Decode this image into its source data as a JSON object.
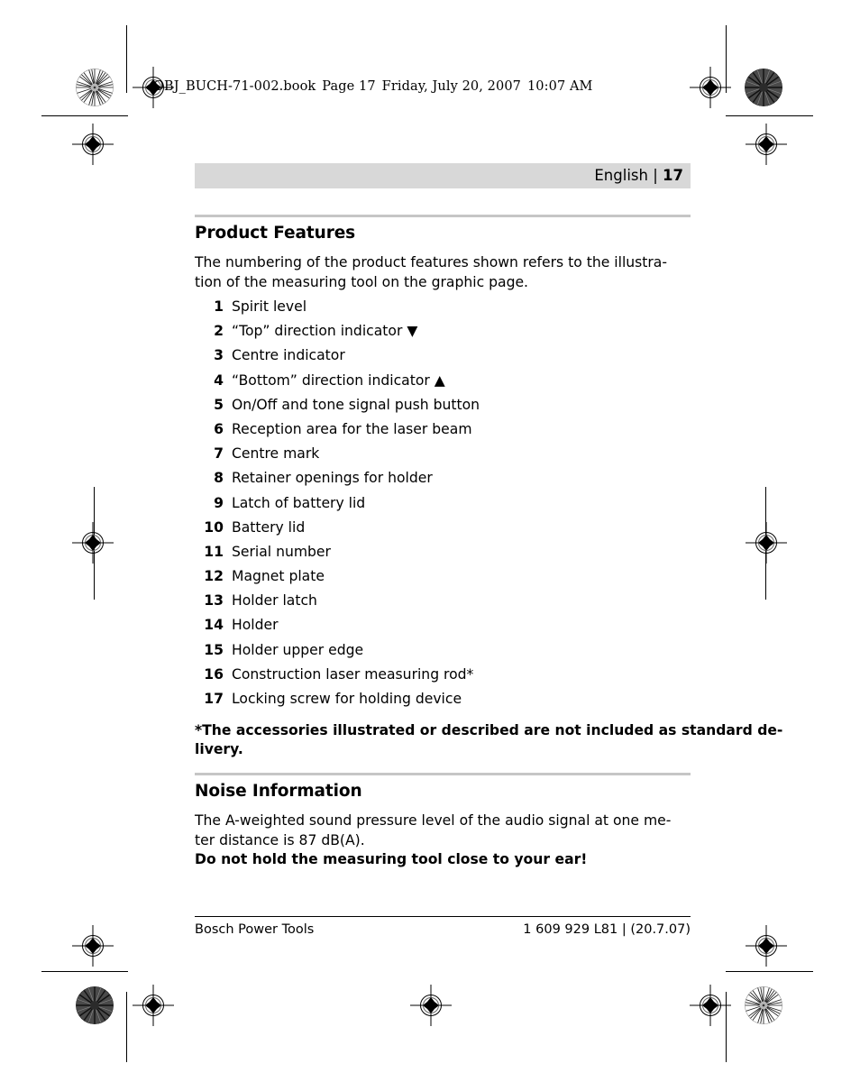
{
  "file_header": {
    "filename": "OBJ_BUCH-71-002.book",
    "page_label": "Page 17",
    "date": "Friday, July 20, 2007",
    "time": "10:07 AM"
  },
  "running_head": {
    "language": "English",
    "separator": "|",
    "page_number": "17"
  },
  "sections": {
    "product_features": {
      "heading": "Product Features",
      "intro_line1": "The numbering of the product features shown refers to the illustra-",
      "intro_line2": "tion of the measuring tool on the graphic page.",
      "items": [
        {
          "num": "1",
          "label": "Spirit level"
        },
        {
          "num": "2",
          "label": "“Top” direction indicator ▼"
        },
        {
          "num": "3",
          "label": "Centre indicator"
        },
        {
          "num": "4",
          "label": "“Bottom” direction indicator ▲"
        },
        {
          "num": "5",
          "label": "On/Off and tone signal push button"
        },
        {
          "num": "6",
          "label": "Reception area for the laser beam"
        },
        {
          "num": "7",
          "label": "Centre mark"
        },
        {
          "num": "8",
          "label": "Retainer openings for holder"
        },
        {
          "num": "9",
          "label": "Latch of battery lid"
        },
        {
          "num": "10",
          "label": "Battery lid"
        },
        {
          "num": "11",
          "label": "Serial number"
        },
        {
          "num": "12",
          "label": "Magnet plate"
        },
        {
          "num": "13",
          "label": "Holder latch"
        },
        {
          "num": "14",
          "label": "Holder"
        },
        {
          "num": "15",
          "label": "Holder upper edge"
        },
        {
          "num": "16",
          "label": "Construction laser measuring rod*"
        },
        {
          "num": "17",
          "label": "Locking screw for holding device"
        }
      ],
      "footnote_line1": "*The accessories illustrated or described are not included as standard de-",
      "footnote_line2": "livery."
    },
    "noise_information": {
      "heading": "Noise Information",
      "body_line1": "The A-weighted sound pressure level of the audio signal at one me-",
      "body_line2": "ter distance is 87 dB(A).",
      "warning": "Do not hold the measuring tool close to your ear!"
    }
  },
  "footer": {
    "left": "Bosch Power Tools",
    "right": "1 609 929 L81 | (20.7.07)"
  },
  "colors": {
    "head_band": "#d8d8d8",
    "section_rule": "#c6c6c6",
    "text": "#000000"
  }
}
